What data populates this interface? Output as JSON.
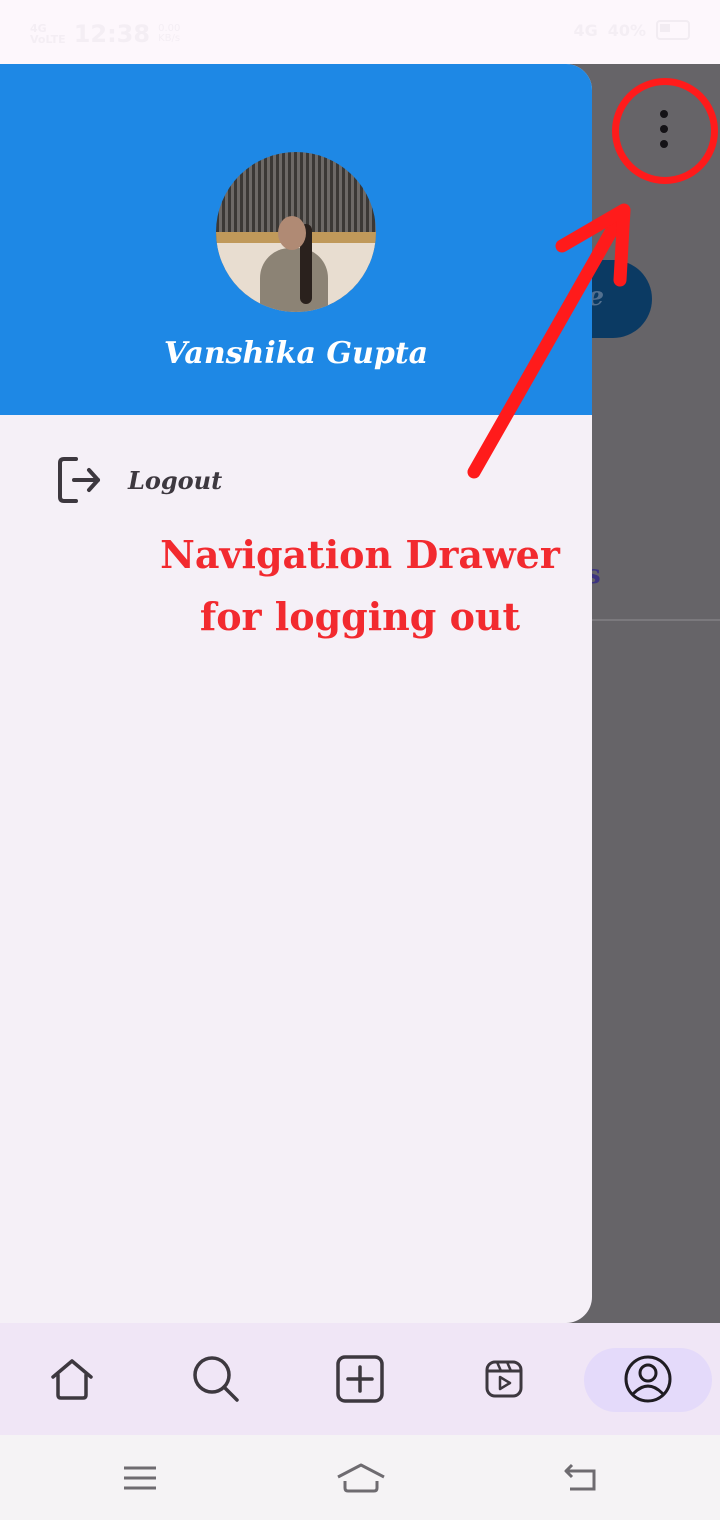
{
  "status_bar": {
    "network": "4G\nVoLTE",
    "time": "12:38",
    "speed": "0.00\nKB/s",
    "signal": "4G",
    "battery": "40%"
  },
  "drawer": {
    "user_name": "Vanshika Gupta",
    "items": [
      {
        "label": "Logout",
        "icon": "logout-icon"
      }
    ]
  },
  "background": {
    "action_button_stub": "e",
    "tab_stub": "s"
  },
  "annotation": {
    "line1": "Navigation Drawer",
    "line2": "for logging out",
    "color": "#ff1b1b"
  },
  "bottom_nav": {
    "items": [
      {
        "icon": "home-icon"
      },
      {
        "icon": "search-icon"
      },
      {
        "icon": "add-post-icon"
      },
      {
        "icon": "reels-icon"
      },
      {
        "icon": "profile-icon",
        "selected": true
      }
    ]
  },
  "colors": {
    "drawer_header": "#1e88e5",
    "drawer_body": "#f5f0f7",
    "scrim": "#666468",
    "nav_background": "#f0e6f6",
    "nav_selected_pill": "#e4dafa"
  }
}
